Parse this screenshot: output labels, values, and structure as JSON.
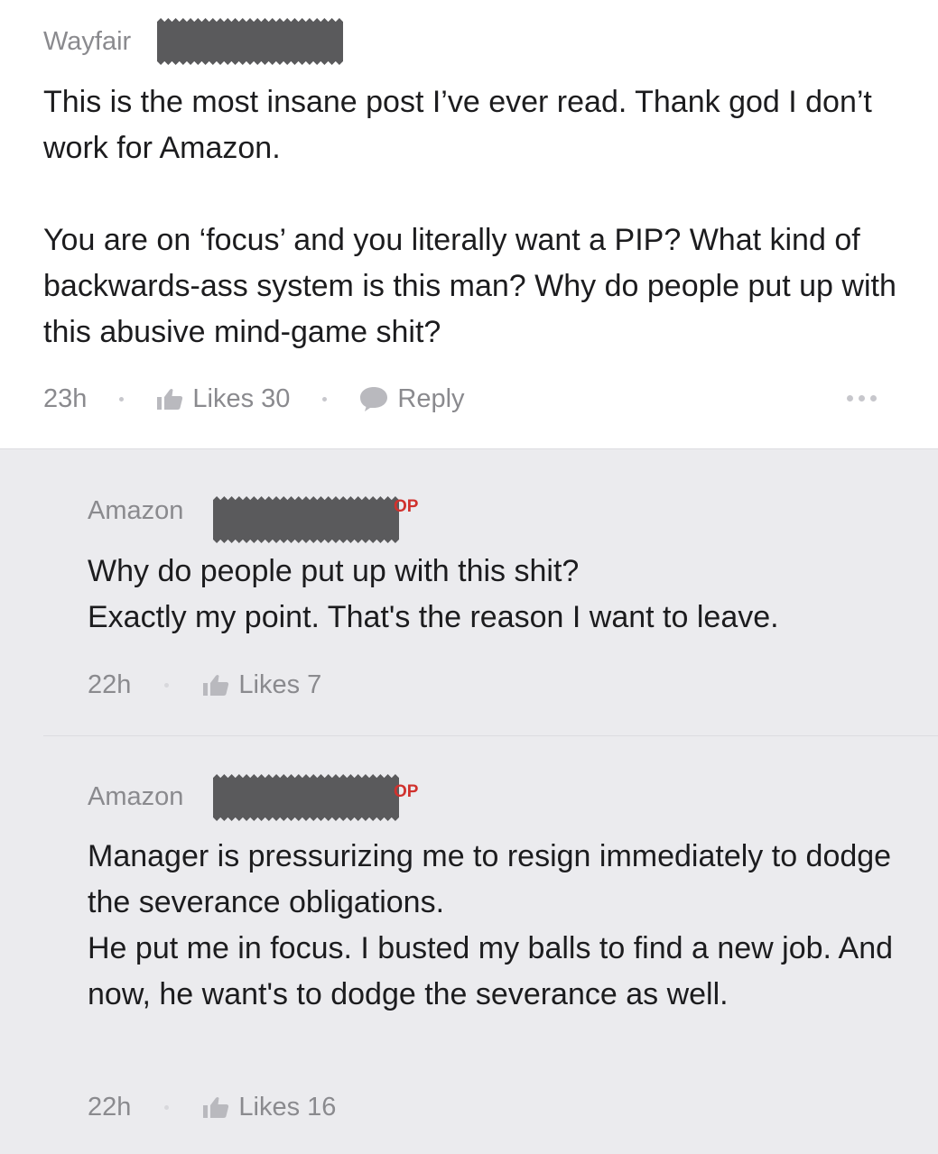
{
  "comment": {
    "company": "Wayfair",
    "body": [
      "This is the most insane post I’ve ever read. Thank god I don’t work for Amazon.",
      "You are on ‘focus’ and you literally want a PIP? What kind of backwards-ass system is this man? Why do people put up with this abusive mind-game shit?"
    ],
    "time": "23h",
    "likes": "Likes 30",
    "reply": "Reply"
  },
  "replies": [
    {
      "company": "Amazon",
      "badge": "OP",
      "body": [
        "Why do people put up with this shit?",
        "Exactly my point. That's the reason I want to leave."
      ],
      "time": "22h",
      "likes": "Likes 7"
    },
    {
      "company": "Amazon",
      "badge": "OP",
      "body": [
        "Manager is pressurizing me to resign immediately to dodge the severance obligations.",
        "He put me in focus. I busted my balls to find a new job. And now, he want's to dodge the severance as well."
      ],
      "time": "22h",
      "likes": "Likes 16"
    }
  ],
  "icons": {
    "like": "thumbs-up-icon",
    "reply": "speech-bubble-icon",
    "more": "ellipsis-icon"
  },
  "colors": {
    "op_badge": "#d0312d",
    "reply_background": "#ebebee",
    "meta_text": "#8a8a8e"
  }
}
